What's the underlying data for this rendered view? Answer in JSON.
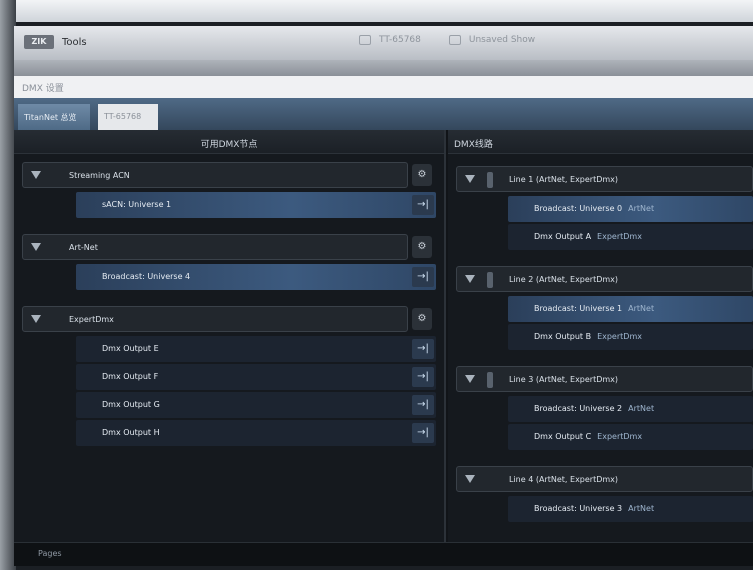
{
  "app": {
    "logo_text": "ZIK",
    "title": "Tools",
    "console_name": "TT-65768",
    "show_status": "Unsaved Show"
  },
  "dialog": {
    "title": "DMX 设置",
    "tabs": [
      {
        "label": "TitanNet 总览",
        "active": true
      },
      {
        "label": "TT-65768",
        "active": false
      }
    ]
  },
  "left_panel": {
    "header": "可用DMX节点",
    "groups": [
      {
        "name": "Streaming ACN",
        "items": [
          {
            "label": "sACN: Universe 1",
            "selected": true
          }
        ]
      },
      {
        "name": "Art-Net",
        "items": [
          {
            "label": "Broadcast: Universe 4",
            "selected": true
          }
        ]
      },
      {
        "name": "ExpertDmx",
        "items": [
          {
            "label": "Dmx Output E",
            "selected": false
          },
          {
            "label": "Dmx Output F",
            "selected": false
          },
          {
            "label": "Dmx Output G",
            "selected": false
          },
          {
            "label": "Dmx Output H",
            "selected": false
          }
        ]
      }
    ],
    "gear_symbol": "⚙",
    "patch_symbol": "→|"
  },
  "right_panel": {
    "header": "DMX线路",
    "lines": [
      {
        "name": "Line 1",
        "protocols": "(ArtNet, ExpertDmx)",
        "items": [
          {
            "label": "Broadcast: Universe 0",
            "type": "ArtNet",
            "selected": true
          },
          {
            "label": "Dmx Output A",
            "type": "ExpertDmx",
            "selected": false
          }
        ]
      },
      {
        "name": "Line 2",
        "protocols": "(ArtNet, ExpertDmx)",
        "items": [
          {
            "label": "Broadcast: Universe 1",
            "type": "ArtNet",
            "selected": true
          },
          {
            "label": "Dmx Output B",
            "type": "ExpertDmx",
            "selected": false
          }
        ]
      },
      {
        "name": "Line 3",
        "protocols": "(ArtNet, ExpertDmx)",
        "items": [
          {
            "label": "Broadcast: Universe 2",
            "type": "ArtNet",
            "selected": false
          },
          {
            "label": "Dmx Output C",
            "type": "ExpertDmx",
            "selected": false
          }
        ]
      },
      {
        "name": "Line 4",
        "protocols": "(ArtNet, ExpertDmx)",
        "items": [
          {
            "label": "Broadcast: Universe 3",
            "type": "ArtNet",
            "selected": false
          }
        ]
      }
    ]
  },
  "status_bar": {
    "text": "Pages"
  },
  "colors": {
    "selected_row": "#3c5a7f",
    "tab_active": "#6f8aa6",
    "background": "#15191e"
  }
}
